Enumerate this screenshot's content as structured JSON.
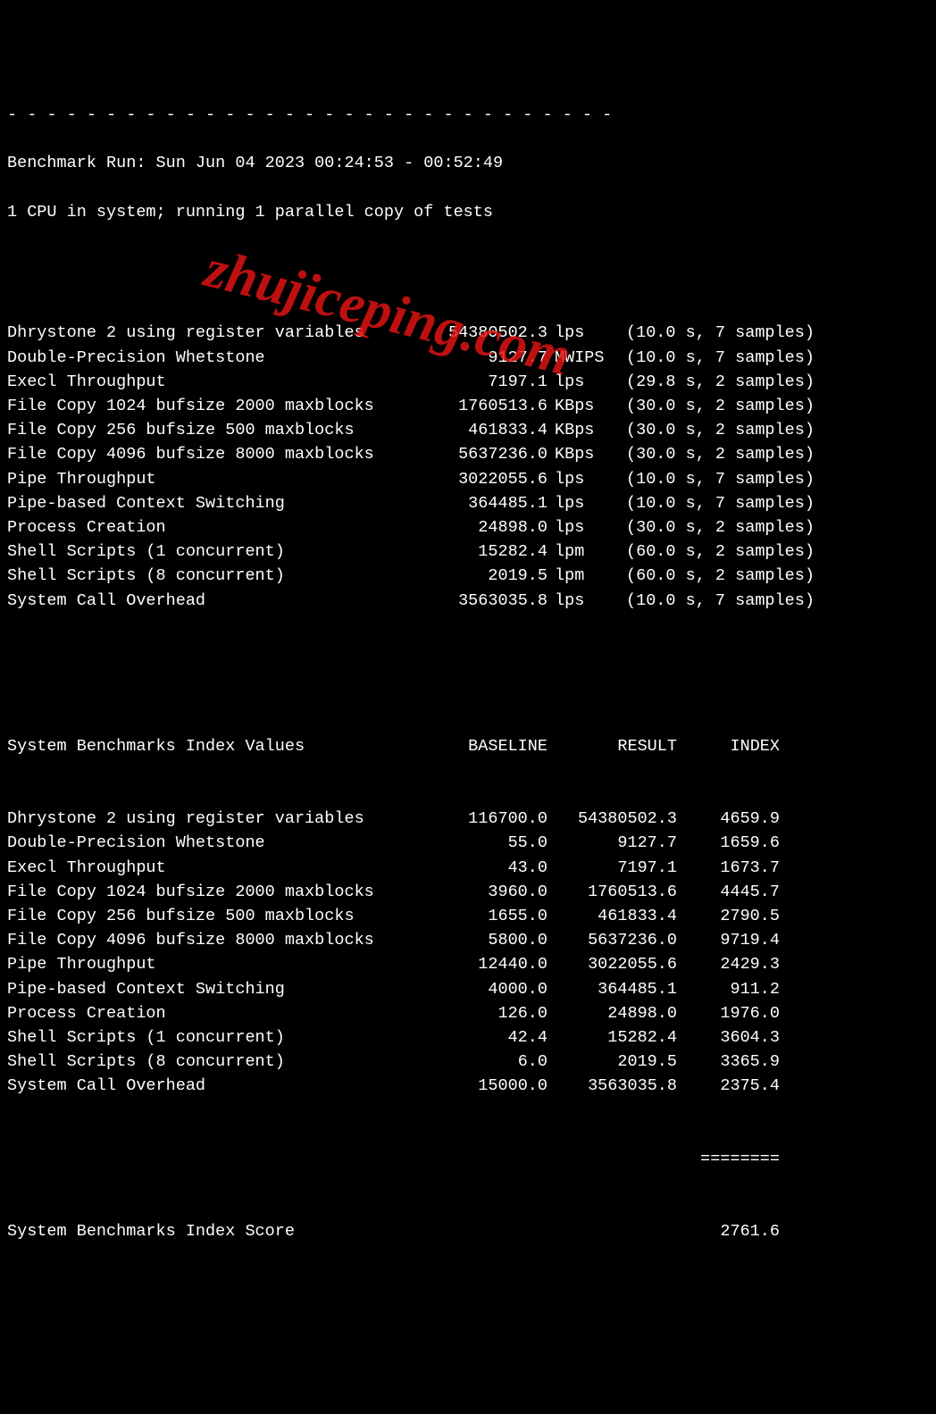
{
  "divider": "- - - - - - - - - - - - - - - - - - - - - - - - - - - - - - -",
  "header": {
    "run_line": "Benchmark Run: Sun Jun 04 2023 00:24:53 - 00:52:49",
    "cpu_line": "1 CPU in system; running 1 parallel copy of tests"
  },
  "results": [
    {
      "name": "Dhrystone 2 using register variables",
      "value": "54380502.3",
      "unit": "lps",
      "timing": "(10.0 s, 7 samples)"
    },
    {
      "name": "Double-Precision Whetstone",
      "value": "9127.7",
      "unit": "MWIPS",
      "timing": "(10.0 s, 7 samples)"
    },
    {
      "name": "Execl Throughput",
      "value": "7197.1",
      "unit": "lps",
      "timing": "(29.8 s, 2 samples)"
    },
    {
      "name": "File Copy 1024 bufsize 2000 maxblocks",
      "value": "1760513.6",
      "unit": "KBps",
      "timing": "(30.0 s, 2 samples)"
    },
    {
      "name": "File Copy 256 bufsize 500 maxblocks",
      "value": "461833.4",
      "unit": "KBps",
      "timing": "(30.0 s, 2 samples)"
    },
    {
      "name": "File Copy 4096 bufsize 8000 maxblocks",
      "value": "5637236.0",
      "unit": "KBps",
      "timing": "(30.0 s, 2 samples)"
    },
    {
      "name": "Pipe Throughput",
      "value": "3022055.6",
      "unit": "lps",
      "timing": "(10.0 s, 7 samples)"
    },
    {
      "name": "Pipe-based Context Switching",
      "value": "364485.1",
      "unit": "lps",
      "timing": "(10.0 s, 7 samples)"
    },
    {
      "name": "Process Creation",
      "value": "24898.0",
      "unit": "lps",
      "timing": "(30.0 s, 2 samples)"
    },
    {
      "name": "Shell Scripts (1 concurrent)",
      "value": "15282.4",
      "unit": "lpm",
      "timing": "(60.0 s, 2 samples)"
    },
    {
      "name": "Shell Scripts (8 concurrent)",
      "value": "2019.5",
      "unit": "lpm",
      "timing": "(60.0 s, 2 samples)"
    },
    {
      "name": "System Call Overhead",
      "value": "3563035.8",
      "unit": "lps",
      "timing": "(10.0 s, 7 samples)"
    }
  ],
  "index_header": {
    "title": "System Benchmarks Index Values",
    "baseline": "BASELINE",
    "result": "RESULT",
    "index": "INDEX"
  },
  "indices": [
    {
      "name": "Dhrystone 2 using register variables",
      "baseline": "116700.0",
      "result": "54380502.3",
      "index": "4659.9"
    },
    {
      "name": "Double-Precision Whetstone",
      "baseline": "55.0",
      "result": "9127.7",
      "index": "1659.6"
    },
    {
      "name": "Execl Throughput",
      "baseline": "43.0",
      "result": "7197.1",
      "index": "1673.7"
    },
    {
      "name": "File Copy 1024 bufsize 2000 maxblocks",
      "baseline": "3960.0",
      "result": "1760513.6",
      "index": "4445.7"
    },
    {
      "name": "File Copy 256 bufsize 500 maxblocks",
      "baseline": "1655.0",
      "result": "461833.4",
      "index": "2790.5"
    },
    {
      "name": "File Copy 4096 bufsize 8000 maxblocks",
      "baseline": "5800.0",
      "result": "5637236.0",
      "index": "9719.4"
    },
    {
      "name": "Pipe Throughput",
      "baseline": "12440.0",
      "result": "3022055.6",
      "index": "2429.3"
    },
    {
      "name": "Pipe-based Context Switching",
      "baseline": "4000.0",
      "result": "364485.1",
      "index": "911.2"
    },
    {
      "name": "Process Creation",
      "baseline": "126.0",
      "result": "24898.0",
      "index": "1976.0"
    },
    {
      "name": "Shell Scripts (1 concurrent)",
      "baseline": "42.4",
      "result": "15282.4",
      "index": "3604.3"
    },
    {
      "name": "Shell Scripts (8 concurrent)",
      "baseline": "6.0",
      "result": "2019.5",
      "index": "3365.9"
    },
    {
      "name": "System Call Overhead",
      "baseline": "15000.0",
      "result": "3563035.8",
      "index": "2375.4"
    }
  ],
  "score_divider": "========",
  "score": {
    "label": "System Benchmarks Index Score",
    "value": "2761.6"
  },
  "watermark": "zhujiceping.com"
}
